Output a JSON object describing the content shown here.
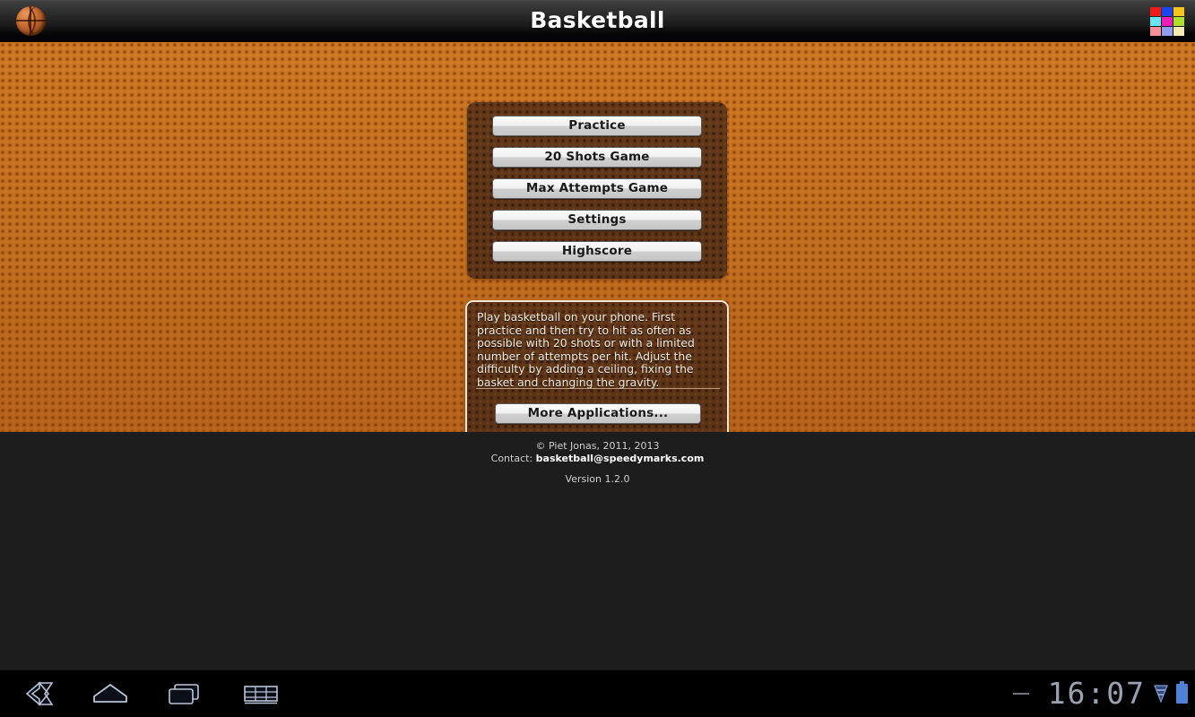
{
  "titlebar": {
    "title": "Basketball",
    "app_icon": "basketball-icon",
    "apps_grid_icon": "apps-grid-icon",
    "grid_colors": [
      "#ef1a1a",
      "#1a46ef",
      "#f5c518",
      "#66e6f0",
      "#ef1aba",
      "#aee028",
      "#f5909a",
      "#8f9cf0",
      "#f3ecae"
    ],
    "background_color": "#000000"
  },
  "menu": {
    "buttons": [
      {
        "label": "Practice",
        "name": "practice-button"
      },
      {
        "label": "20 Shots Game",
        "name": "shots-game-button"
      },
      {
        "label": "Max Attempts Game",
        "name": "max-attempts-game-button"
      },
      {
        "label": "Settings",
        "name": "settings-button"
      },
      {
        "label": "Highscore",
        "name": "highscore-button"
      }
    ]
  },
  "info": {
    "description": "Play basketball on your phone. First practice and then try to hit as often as possible with 20 shots or with a limited number of attempts per hit. Adjust the difficulty by adding a ceiling, fixing the basket and changing the gravity.",
    "more_apps_label": "More Applications..."
  },
  "footer": {
    "copyright": "© Piet Jonas, 2011, 2013",
    "contact_label": "Contact: ",
    "contact_email": "basketball@speedymarks.com",
    "version": "Version 1.2.0"
  },
  "navbar": {
    "back_icon": "back-arrow-icon",
    "home_icon": "home-icon",
    "recent_icon": "recent-apps-icon",
    "keyboard_icon": "keyboard-icon",
    "clock": "16:07",
    "signal_icon": "signal-down-icon",
    "battery_icon": "battery-icon",
    "minus_icon": "minus-icon"
  },
  "theme": {
    "court_orange": "#c4701f",
    "panel_brown": "#5d3417",
    "button_light": "#f0f0f0",
    "accent_blue": "#4e82d6"
  }
}
